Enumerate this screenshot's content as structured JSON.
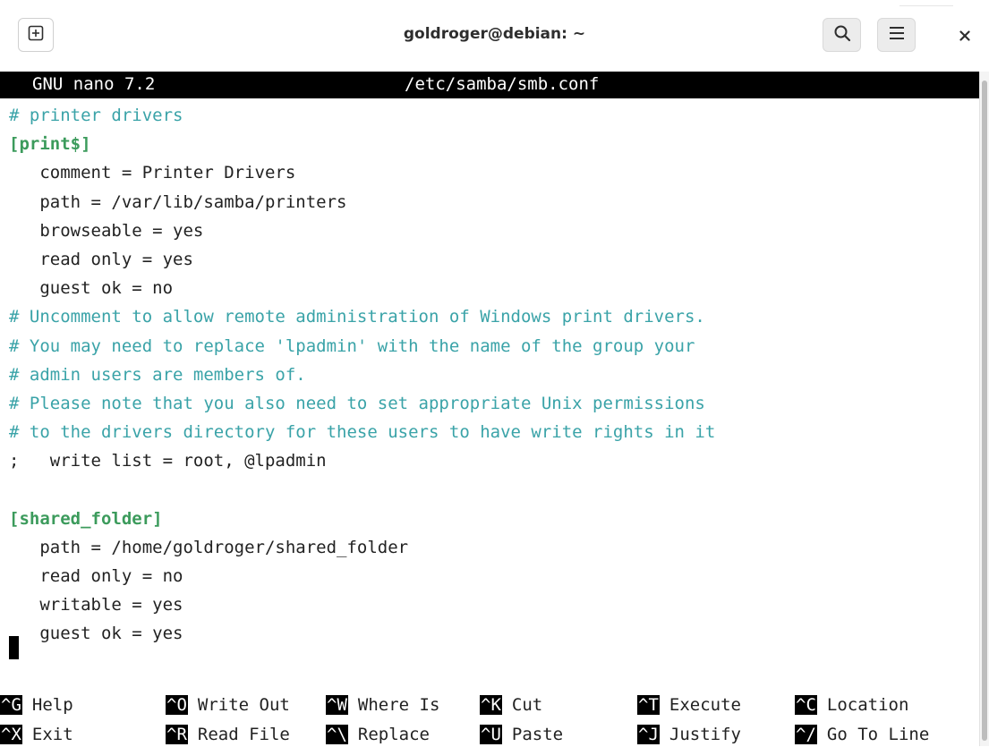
{
  "window": {
    "title": "goldroger@debian: ~"
  },
  "toolbar": {
    "new_tab_icon": "plus-box-icon",
    "search_icon": "search-icon",
    "menu_icon": "hamburger-menu-icon",
    "close_icon": "close-icon"
  },
  "nano": {
    "version": "GNU nano 7.2",
    "filename": "/etc/samba/smb.conf"
  },
  "editor": {
    "lines": [
      {
        "text": "# printer drivers",
        "type": "comment"
      },
      {
        "text": "[print$]",
        "type": "section"
      },
      {
        "text": "   comment = Printer Drivers",
        "type": "plain"
      },
      {
        "text": "   path = /var/lib/samba/printers",
        "type": "plain"
      },
      {
        "text": "   browseable = yes",
        "type": "plain"
      },
      {
        "text": "   read only = yes",
        "type": "plain"
      },
      {
        "text": "   guest ok = no",
        "type": "plain"
      },
      {
        "text": "# Uncomment to allow remote administration of Windows print drivers.",
        "type": "comment"
      },
      {
        "text": "# You may need to replace 'lpadmin' with the name of the group your",
        "type": "comment"
      },
      {
        "text": "# admin users are members of.",
        "type": "comment"
      },
      {
        "text": "# Please note that you also need to set appropriate Unix permissions",
        "type": "comment"
      },
      {
        "text": "# to the drivers directory for these users to have write rights in it",
        "type": "comment"
      },
      {
        "text": ";   write list = root, @lpadmin",
        "type": "plain"
      },
      {
        "text": "",
        "type": "plain"
      },
      {
        "text": "[shared_folder]",
        "type": "section"
      },
      {
        "text": "   path = /home/goldroger/shared_folder",
        "type": "plain"
      },
      {
        "text": "   read only = no",
        "type": "plain"
      },
      {
        "text": "   writable = yes",
        "type": "plain"
      },
      {
        "text": "   guest ok = yes",
        "type": "plain"
      }
    ]
  },
  "shortcuts": {
    "row1": [
      {
        "key": "^G",
        "label": "Help"
      },
      {
        "key": "^O",
        "label": "Write Out"
      },
      {
        "key": "^W",
        "label": "Where Is"
      },
      {
        "key": "^K",
        "label": "Cut"
      },
      {
        "key": "^T",
        "label": "Execute"
      },
      {
        "key": "^C",
        "label": "Location"
      }
    ],
    "row2": [
      {
        "key": "^X",
        "label": "Exit"
      },
      {
        "key": "^R",
        "label": "Read File"
      },
      {
        "key": "^\\",
        "label": "Replace"
      },
      {
        "key": "^U",
        "label": "Paste"
      },
      {
        "key": "^J",
        "label": "Justify"
      },
      {
        "key": "^/",
        "label": "Go To Line"
      }
    ]
  }
}
